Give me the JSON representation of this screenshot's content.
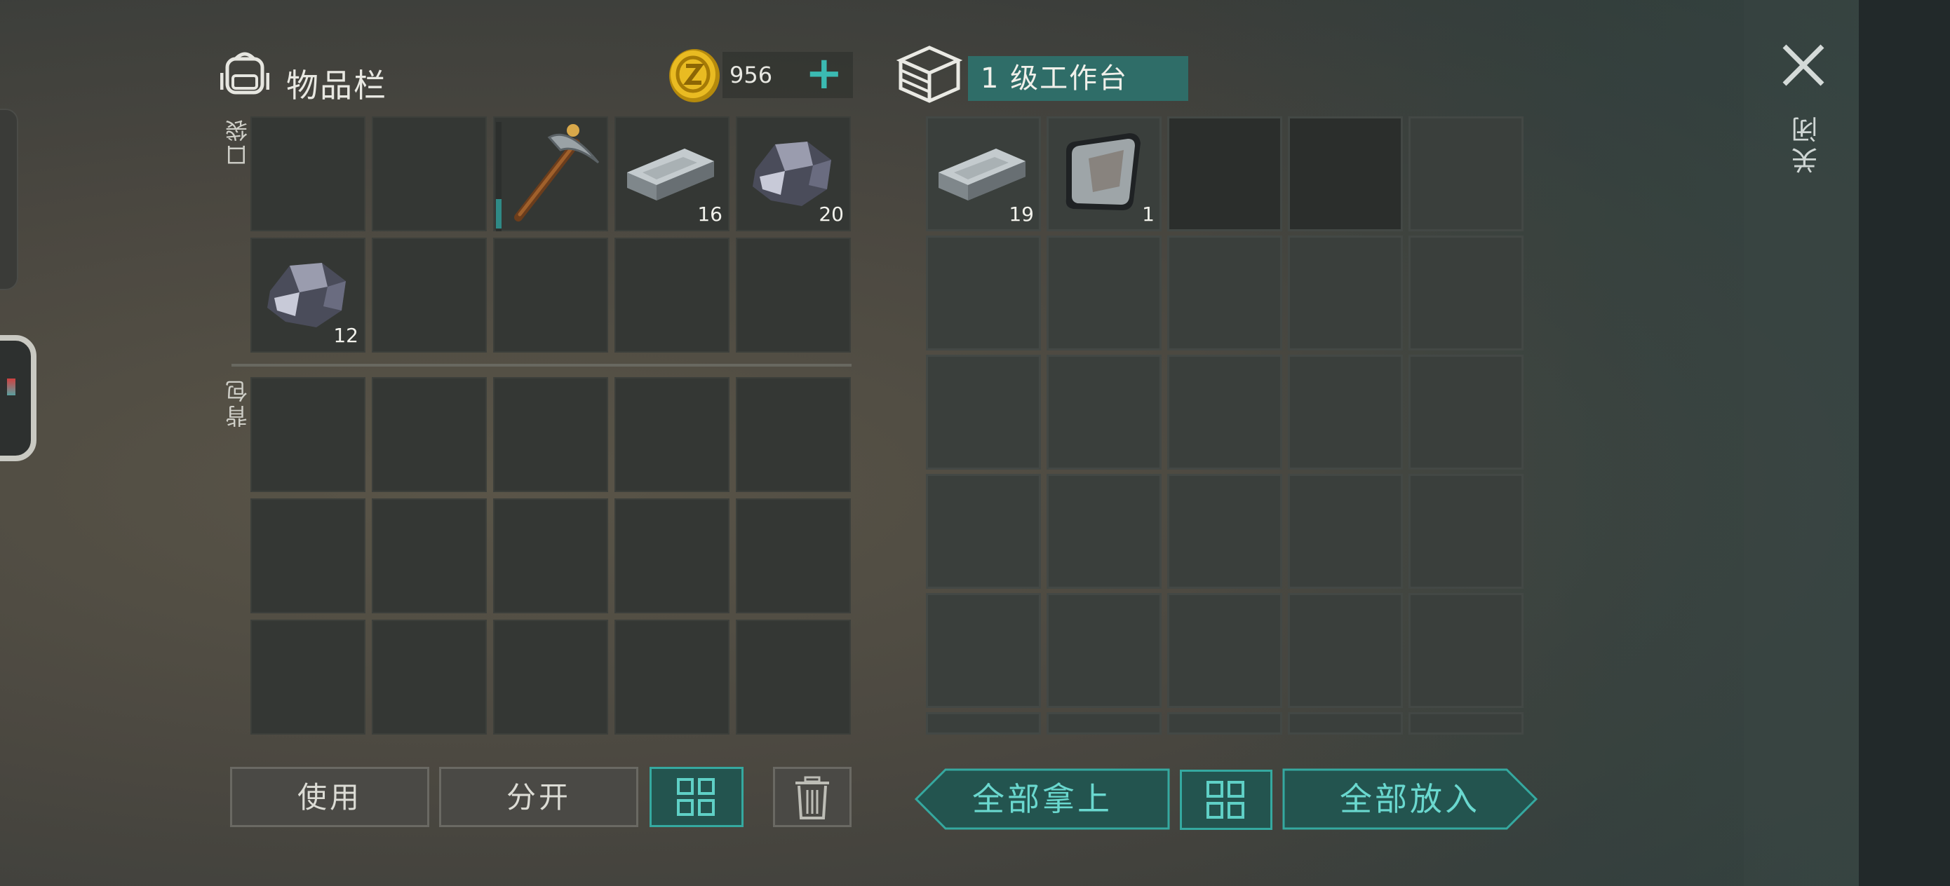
{
  "inventory": {
    "title": "物品栏",
    "pocket_label": "口袋",
    "backpack_label": "背包",
    "coins": "956",
    "coin_plus": "+",
    "pocket_slots": [
      {
        "item": "",
        "qty": ""
      },
      {
        "item": "",
        "qty": ""
      },
      {
        "item": "pickaxe",
        "qty": ""
      },
      {
        "item": "iron-ingot",
        "qty": "16"
      },
      {
        "item": "ore",
        "qty": "20"
      },
      {
        "item": "ore",
        "qty": "12"
      },
      {
        "item": "",
        "qty": ""
      },
      {
        "item": "",
        "qty": ""
      },
      {
        "item": "",
        "qty": ""
      },
      {
        "item": "",
        "qty": ""
      }
    ],
    "buttons": {
      "use": "使用",
      "split": "分开"
    }
  },
  "workbench": {
    "title": "1 级工作台",
    "slots": [
      {
        "item": "iron-ingot",
        "qty": "19"
      },
      {
        "item": "steel-plate",
        "qty": "1"
      }
    ],
    "buttons": {
      "take_all": "全部拿上",
      "put_all": "全部放入"
    }
  },
  "close_label": "关闭",
  "icons": {
    "bag": "backpack-icon",
    "coin": "coin-icon",
    "workbench": "workbench-icon",
    "sort": "sort-grid-icon",
    "trash": "trash-icon",
    "close": "close-icon"
  },
  "colors": {
    "accent": "#35a9a0",
    "title_bar": "#2f6d68",
    "coin": "#e3b21c"
  }
}
